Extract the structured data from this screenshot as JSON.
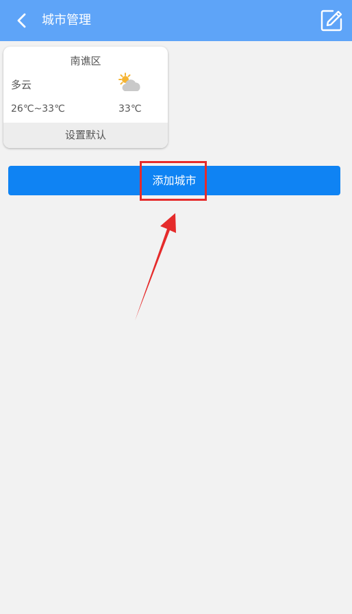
{
  "header": {
    "title": "城市管理",
    "back_icon": "chevron-left-icon",
    "edit_icon": "edit-icon"
  },
  "cities": [
    {
      "name": "南谯区",
      "weather": "多云",
      "temp_range": "26℃~33℃",
      "current_temp": "33℃",
      "weather_icon": "partly-cloudy-icon",
      "set_default_label": "设置默认"
    }
  ],
  "add_city_label": "添加城市",
  "colors": {
    "header_bg": "#5ea4f8",
    "page_bg": "#f2f2f2",
    "primary_button": "#0f83f3",
    "annotation_red": "#e52b2b"
  }
}
